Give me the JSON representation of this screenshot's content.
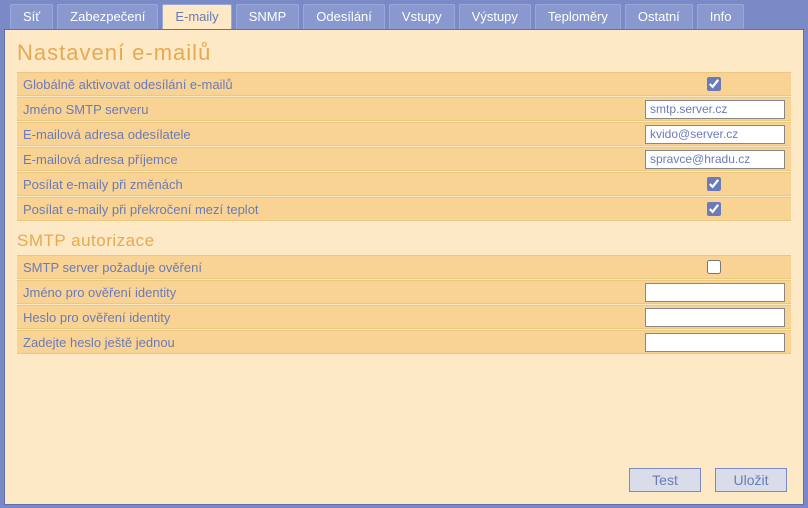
{
  "tabs": {
    "0": "Síť",
    "1": "Zabezpečení",
    "2": "E-maily",
    "3": "SNMP",
    "4": "Odesílání",
    "5": "Vstupy",
    "6": "Výstupy",
    "7": "Teploměry",
    "8": "Ostatní",
    "9": "Info"
  },
  "section1_title": "Nastavení e-mailů",
  "rows": {
    "global_enable": "Globálně aktivovat odesílání e-mailů",
    "smtp_server_label": "Jméno SMTP serveru",
    "smtp_server_value": "smtp.server.cz",
    "sender_label": "E-mailová adresa odesílatele",
    "sender_value": "kvido@server.cz",
    "recipient_label": "E-mailová adresa příjemce",
    "recipient_value": "spravce@hradu.cz",
    "on_change": "Posílat e-maily při změnách",
    "on_limit": "Posílat e-maily při překročení mezí teplot"
  },
  "section2_title": "SMTP autorizace",
  "auth": {
    "requires": "SMTP server požaduje ověření",
    "user_label": "Jméno pro ověření identity",
    "user_value": "",
    "pass_label": "Heslo pro ověření identity",
    "pass_value": "",
    "pass2_label": "Zadejte heslo ještě jednou",
    "pass2_value": ""
  },
  "buttons": {
    "test": "Test",
    "save": "Uložit"
  },
  "state": {
    "global_enable": true,
    "on_change": true,
    "on_limit": true,
    "auth_required": false
  }
}
